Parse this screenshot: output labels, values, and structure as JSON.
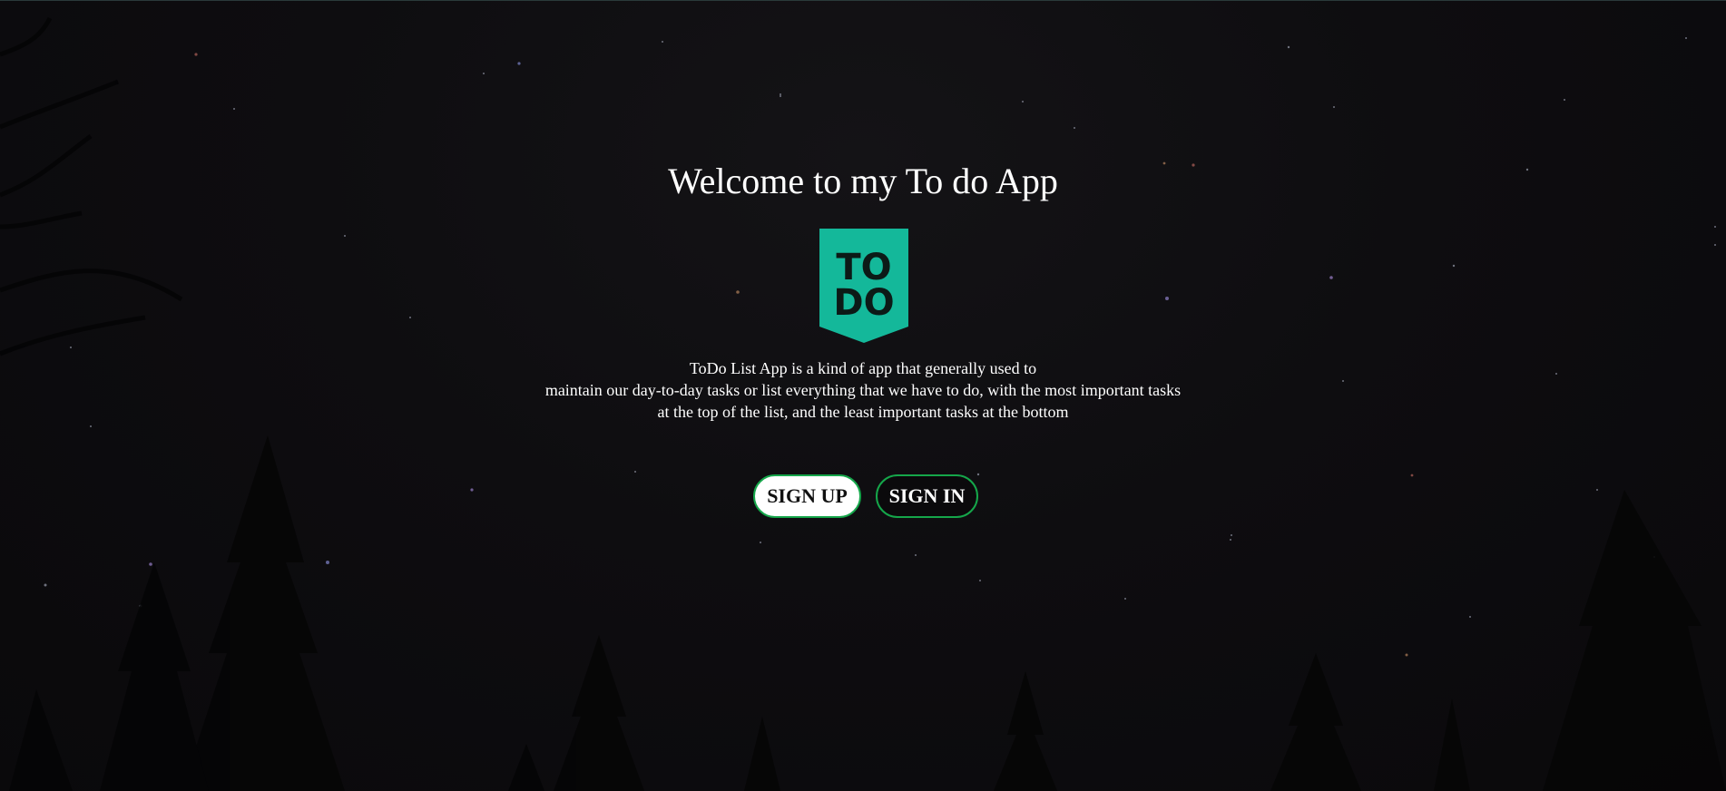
{
  "page": {
    "title": "Welcome to my To do App",
    "logo": {
      "text_line1": "TO",
      "text_line2": "DO",
      "color": "#14b89a",
      "icon": "todo-logo-banner"
    },
    "description": {
      "line1": "ToDo List App is a kind of app that generally used to",
      "line2": "maintain our day-to-day tasks or list everything that we have to do, with the most important tasks",
      "line3": "at the top of the list, and the least important tasks at the bottom"
    },
    "buttons": {
      "signup_label": "SIGN UP",
      "signin_label": "SIGN IN"
    }
  },
  "colors": {
    "background": "#0e0d10",
    "accent_border": "#15a64a",
    "text": "#ffffff"
  }
}
